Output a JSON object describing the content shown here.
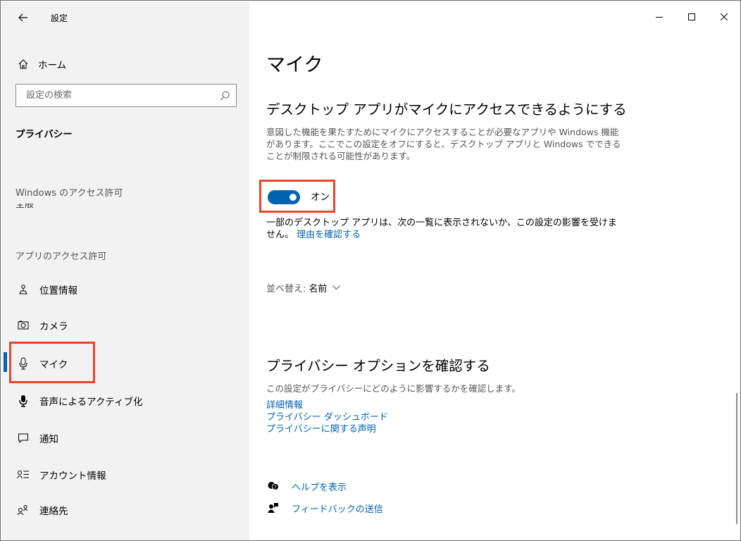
{
  "window": {
    "title": "設定",
    "controls": [
      "minimize-icon",
      "maximize-icon",
      "close-icon"
    ]
  },
  "sidebar": {
    "home": "ホーム",
    "search_placeholder": "設定の検索",
    "category": "プライバシー",
    "section_windows": "Windows のアクセス許可",
    "section_apps": "アプリのアクセス許可",
    "items": [
      {
        "label": "位置情報",
        "icon": "location-icon"
      },
      {
        "label": "カメラ",
        "icon": "camera-icon"
      },
      {
        "label": "マイク",
        "icon": "microphone-icon",
        "selected": true
      },
      {
        "label": "音声によるアクティブ化",
        "icon": "voice-activation-icon"
      },
      {
        "label": "通知",
        "icon": "notification-icon"
      },
      {
        "label": "アカウント情報",
        "icon": "account-info-icon"
      },
      {
        "label": "連絡先",
        "icon": "contacts-icon"
      }
    ]
  },
  "main": {
    "title": "マイク",
    "desktop_heading": "デスクトップ アプリがマイクにアクセスできるようにする",
    "desktop_desc": "意図した機能を果たすためにマイクにアクセスすることが必要なアプリや Windows 機能があります。ここでこの設定をオフにすると、デスクトップ アプリと Windows でできることが制限される可能性があります。",
    "toggle": {
      "state": "オン",
      "on": true
    },
    "note_text": "一部のデスクトップ アプリは、次の一覧に表示されないか、この設定の影響を受けません。",
    "note_link": "理由を確認する",
    "sort_label": "並べ替え:",
    "sort_value": "名前",
    "privacy_heading": "プライバシー オプションを確認する",
    "privacy_desc": "この設定がプライバシーにどのように影響するかを確認します。",
    "links": [
      "詳細情報",
      "プライバシー ダッシュボード",
      "プライバシーに関する声明"
    ],
    "help": "ヘルプを表示",
    "feedback": "フィードバックの送信"
  },
  "colors": {
    "accent": "#0063b1",
    "highlight": "#e8452c",
    "sidebar_bg": "#f2f2f2"
  }
}
